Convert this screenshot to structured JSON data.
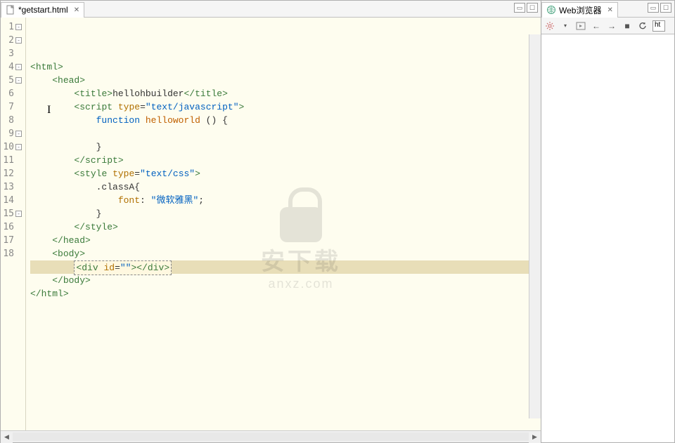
{
  "editor": {
    "tab_title": "*getstart.html",
    "lines": [
      {
        "n": 1,
        "fold": true,
        "indent": 0,
        "segs": [
          {
            "t": "<",
            "c": "tag-bracket"
          },
          {
            "t": "html",
            "c": "tag-name"
          },
          {
            "t": ">",
            "c": "tag-bracket"
          }
        ]
      },
      {
        "n": 2,
        "fold": true,
        "indent": 1,
        "segs": [
          {
            "t": "<",
            "c": "tag-bracket"
          },
          {
            "t": "head",
            "c": "tag-name"
          },
          {
            "t": ">",
            "c": "tag-bracket"
          }
        ]
      },
      {
        "n": 3,
        "fold": false,
        "indent": 2,
        "segs": [
          {
            "t": "<",
            "c": "tag-bracket"
          },
          {
            "t": "title",
            "c": "tag-name"
          },
          {
            "t": ">",
            "c": "tag-bracket"
          },
          {
            "t": "hellohbuilder",
            "c": ""
          },
          {
            "t": "</",
            "c": "tag-bracket"
          },
          {
            "t": "title",
            "c": "tag-name"
          },
          {
            "t": ">",
            "c": "tag-bracket"
          }
        ]
      },
      {
        "n": 4,
        "fold": true,
        "indent": 2,
        "segs": [
          {
            "t": "<",
            "c": "tag-bracket"
          },
          {
            "t": "script",
            "c": "tag-name"
          },
          {
            "t": " ",
            "c": ""
          },
          {
            "t": "type",
            "c": "attr-name"
          },
          {
            "t": "=",
            "c": ""
          },
          {
            "t": "\"text/javascript\"",
            "c": "attr-val"
          },
          {
            "t": ">",
            "c": "tag-bracket"
          }
        ]
      },
      {
        "n": 5,
        "fold": true,
        "indent": 3,
        "segs": [
          {
            "t": "function",
            "c": "keyword"
          },
          {
            "t": " ",
            "c": ""
          },
          {
            "t": "helloworld",
            "c": "funcname"
          },
          {
            "t": " () {",
            "c": ""
          }
        ]
      },
      {
        "n": 6,
        "fold": false,
        "indent": 3,
        "segs": []
      },
      {
        "n": 7,
        "fold": false,
        "indent": 3,
        "segs": [
          {
            "t": "}",
            "c": ""
          }
        ]
      },
      {
        "n": 8,
        "fold": false,
        "indent": 2,
        "segs": [
          {
            "t": "</",
            "c": "tag-bracket"
          },
          {
            "t": "script",
            "c": "tag-name"
          },
          {
            "t": ">",
            "c": "tag-bracket"
          }
        ]
      },
      {
        "n": 9,
        "fold": true,
        "indent": 2,
        "segs": [
          {
            "t": "<",
            "c": "tag-bracket"
          },
          {
            "t": "style",
            "c": "tag-name"
          },
          {
            "t": " ",
            "c": ""
          },
          {
            "t": "type",
            "c": "attr-name"
          },
          {
            "t": "=",
            "c": ""
          },
          {
            "t": "\"text/css\"",
            "c": "attr-val"
          },
          {
            "t": ">",
            "c": "tag-bracket"
          }
        ]
      },
      {
        "n": 10,
        "fold": true,
        "indent": 3,
        "segs": [
          {
            "t": ".classA{",
            "c": ""
          }
        ]
      },
      {
        "n": 11,
        "fold": false,
        "indent": 4,
        "segs": [
          {
            "t": "font",
            "c": "attr-name"
          },
          {
            "t": ": ",
            "c": ""
          },
          {
            "t": "\"微软雅黑\"",
            "c": "string"
          },
          {
            "t": ";",
            "c": ""
          }
        ]
      },
      {
        "n": 12,
        "fold": false,
        "indent": 3,
        "segs": [
          {
            "t": "}",
            "c": ""
          }
        ]
      },
      {
        "n": 13,
        "fold": false,
        "indent": 2,
        "segs": [
          {
            "t": "</",
            "c": "tag-bracket"
          },
          {
            "t": "style",
            "c": "tag-name"
          },
          {
            "t": ">",
            "c": "tag-bracket"
          }
        ]
      },
      {
        "n": 14,
        "fold": false,
        "indent": 1,
        "segs": [
          {
            "t": "</",
            "c": "tag-bracket"
          },
          {
            "t": "head",
            "c": "tag-name"
          },
          {
            "t": ">",
            "c": "tag-bracket"
          }
        ]
      },
      {
        "n": 15,
        "fold": true,
        "indent": 1,
        "segs": [
          {
            "t": "<",
            "c": "tag-bracket"
          },
          {
            "t": "body",
            "c": "tag-name"
          },
          {
            "t": ">",
            "c": "tag-bracket"
          }
        ]
      },
      {
        "n": 16,
        "fold": false,
        "indent": 2,
        "highlighted": true,
        "selbox": true,
        "segs": [
          {
            "t": "<",
            "c": "tag-bracket"
          },
          {
            "t": "div",
            "c": "tag-name"
          },
          {
            "t": " ",
            "c": ""
          },
          {
            "t": "id",
            "c": "attr-name"
          },
          {
            "t": "=",
            "c": ""
          },
          {
            "t": "\"\"",
            "c": "attr-val"
          },
          {
            "t": ">",
            "c": "tag-bracket"
          },
          {
            "t": "</",
            "c": "tag-bracket"
          },
          {
            "t": "div",
            "c": "tag-name"
          },
          {
            "t": ">",
            "c": "tag-bracket"
          }
        ]
      },
      {
        "n": 17,
        "fold": false,
        "indent": 1,
        "segs": [
          {
            "t": "</",
            "c": "tag-bracket"
          },
          {
            "t": "body",
            "c": "tag-name"
          },
          {
            "t": ">",
            "c": "tag-bracket"
          }
        ]
      },
      {
        "n": 18,
        "fold": false,
        "indent": 0,
        "segs": [
          {
            "t": "</",
            "c": "tag-bracket"
          },
          {
            "t": "html",
            "c": "tag-name"
          },
          {
            "t": ">",
            "c": "tag-bracket"
          }
        ]
      }
    ]
  },
  "browser": {
    "tab_title": "Web浏览器",
    "url_fragment": "ht"
  },
  "watermark": {
    "cn": "安下载",
    "en": "anxz.com"
  }
}
